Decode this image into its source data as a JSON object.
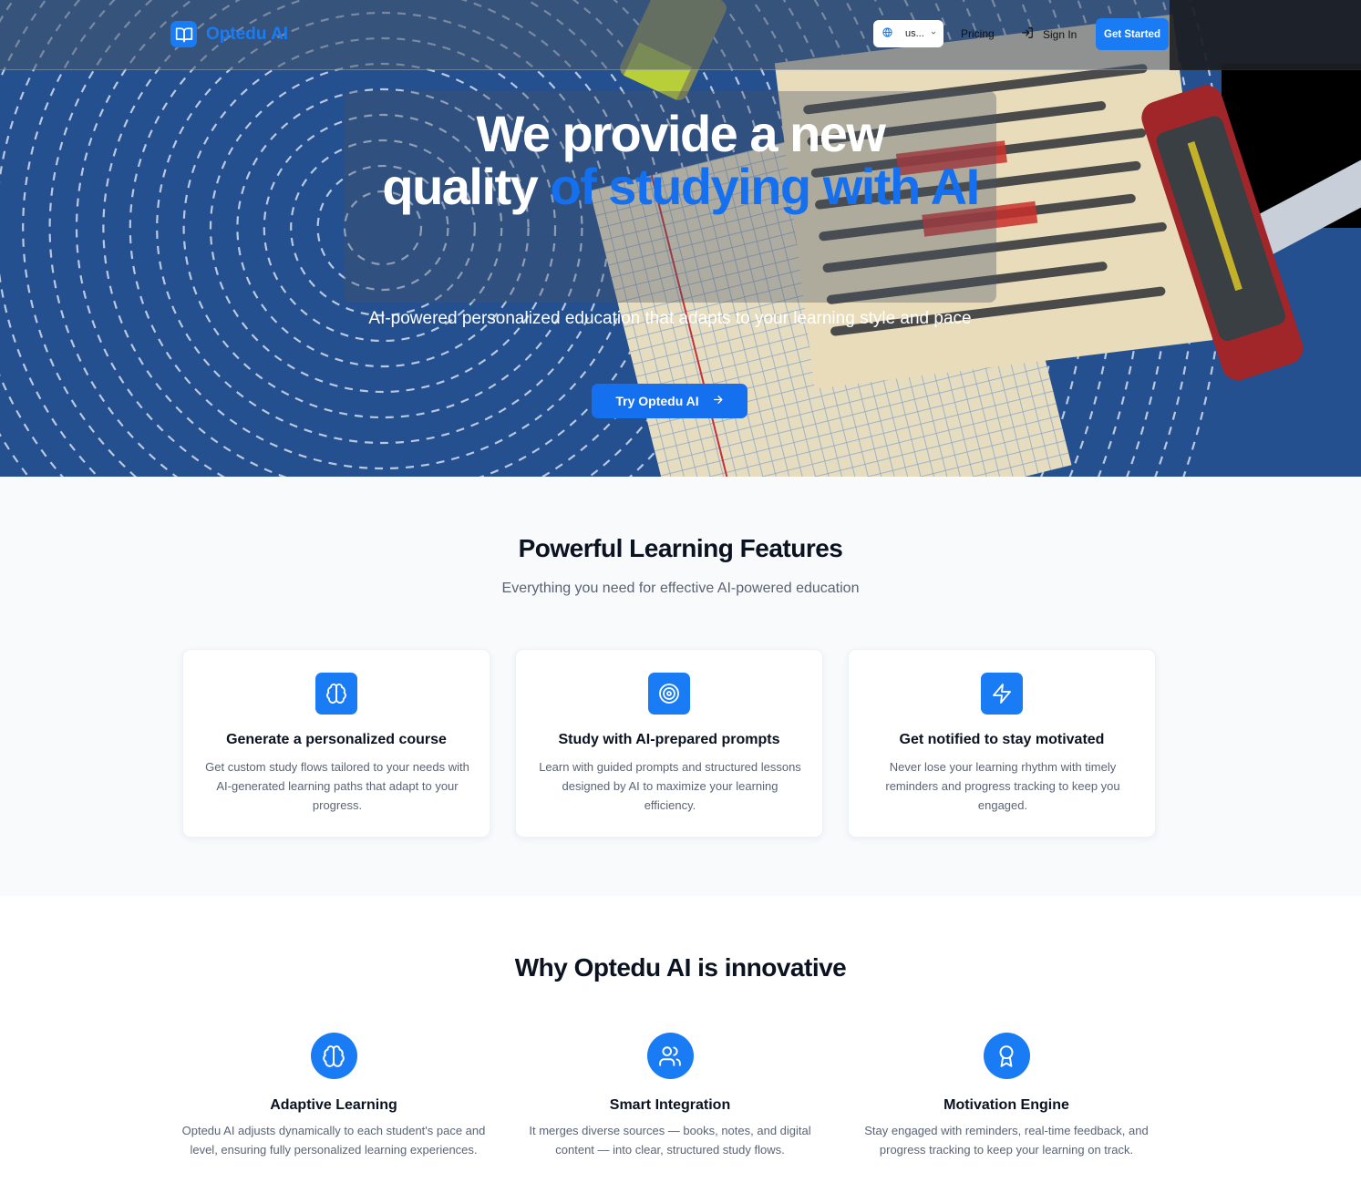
{
  "brand": {
    "name": "Optedu AI",
    "logo_icon": "open-book-icon"
  },
  "nav": {
    "language_value": "us...",
    "language_icon": "globe-icon",
    "pricing_label": "Pricing",
    "signin_label": "Sign In",
    "signin_icon": "log-in-icon",
    "get_started_label": "Get Started"
  },
  "hero": {
    "title_white_1": "We provide a new",
    "title_white_2": "quality",
    "title_blue": "of studying with AI",
    "subtitle": "AI-powered personalized education that adapts to your learning style and pace",
    "cta_label": "Try Optedu AI",
    "cta_icon": "arrow-right-icon"
  },
  "features": {
    "title": "Powerful Learning Features",
    "subtitle": "Everything you need for effective AI-powered education",
    "cards": [
      {
        "icon": "brain-icon",
        "title": "Generate a personalized course",
        "text": "Get custom study flows tailored to your needs with AI-generated learning paths that adapt to your progress."
      },
      {
        "icon": "target-icon",
        "title": "Study with AI-prepared prompts",
        "text": "Learn with guided prompts and structured lessons designed by AI to maximize your learning efficiency."
      },
      {
        "icon": "lightning-icon",
        "title": "Get notified to stay motivated",
        "text": "Never lose your learning rhythm with timely reminders and progress tracking to keep you engaged."
      }
    ]
  },
  "why": {
    "title": "Why Optedu AI is innovative",
    "items": [
      {
        "icon": "brain-icon",
        "title": "Adaptive Learning",
        "text": "Optedu AI adjusts dynamically to each student's pace and level, ensuring fully personalized learning experiences."
      },
      {
        "icon": "users-icon",
        "title": "Smart Integration",
        "text": "It merges diverse sources — books, notes, and digital content — into clear, structured study flows."
      },
      {
        "icon": "award-icon",
        "title": "Motivation Engine",
        "text": "Stay engaged with reminders, real-time feedback, and progress tracking to keep your learning on track."
      }
    ]
  },
  "colors": {
    "accent": "#1a7cf5",
    "hero_bg": "#25508f",
    "section_bg": "#f8fafc"
  }
}
